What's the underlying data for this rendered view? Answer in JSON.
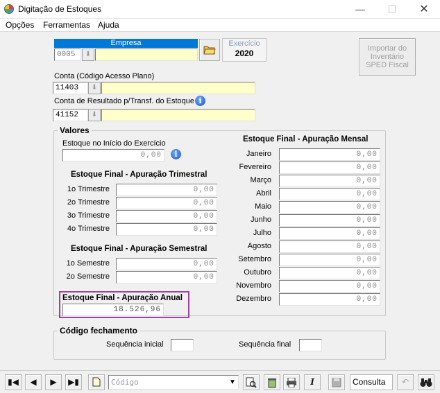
{
  "window": {
    "title": "Digitação de Estoques"
  },
  "menu": [
    "Opções",
    "Ferramentas",
    "Ajuda"
  ],
  "empresa": {
    "header": "Empresa",
    "code": "0005",
    "name": ""
  },
  "exercicio": {
    "label": "Exercício",
    "year": "2020"
  },
  "import_button": {
    "label": "Importar do Inventário SPED Fiscal"
  },
  "conta": {
    "label": "Conta (Código Acesso Plano)",
    "code": "11403",
    "name": ""
  },
  "conta_resultado": {
    "label": "Conta de Resultado p/Transf. do Estoque",
    "code": "41152",
    "name": ""
  },
  "valores": {
    "title": "Valores",
    "inicio_label": "Estoque no Início do Exercício",
    "inicio_value": "0,00",
    "trimestral": {
      "title": "Estoque Final - Apuração Trimestral",
      "items": [
        {
          "label": "1o Trimestre",
          "value": "0,00"
        },
        {
          "label": "2o Trimestre",
          "value": "0,00"
        },
        {
          "label": "3o Trimestre",
          "value": "0,00"
        },
        {
          "label": "4o Trimestre",
          "value": "0,00"
        }
      ]
    },
    "semestral": {
      "title": "Estoque Final - Apuração Semestral",
      "items": [
        {
          "label": "1o Semestre",
          "value": "0,00"
        },
        {
          "label": "2o Semestre",
          "value": "0,00"
        }
      ]
    },
    "anual": {
      "title": "Estoque Final - Apuração Anual",
      "value": "18.526,96"
    },
    "mensal": {
      "title": "Estoque Final - Apuração Mensal",
      "items": [
        {
          "label": "Janeiro",
          "value": "0,00"
        },
        {
          "label": "Fevereiro",
          "value": "0,00"
        },
        {
          "label": "Março",
          "value": "0,00"
        },
        {
          "label": "Abril",
          "value": "0,00"
        },
        {
          "label": "Maio",
          "value": "0,00"
        },
        {
          "label": "Junho",
          "value": "0,00"
        },
        {
          "label": "Julho",
          "value": "0,00"
        },
        {
          "label": "Agosto",
          "value": "0,00"
        },
        {
          "label": "Setembro",
          "value": "0,00"
        },
        {
          "label": "Outubro",
          "value": "0,00"
        },
        {
          "label": "Novembro",
          "value": "0,00"
        },
        {
          "label": "Dezembro",
          "value": "0,00"
        }
      ]
    }
  },
  "fechamento": {
    "title": "Código fechamento",
    "seq_inicial_label": "Sequência inicial",
    "seq_inicial_value": "",
    "seq_final_label": "Sequência final",
    "seq_final_value": ""
  },
  "toolbar": {
    "combo_placeholder": "Código",
    "mode_label": "Consulta",
    "italic_label": "I"
  },
  "colors": {
    "selection_header": "#0078d7",
    "yellow_field": "#ffffcc",
    "highlight_border": "#a040a0"
  }
}
